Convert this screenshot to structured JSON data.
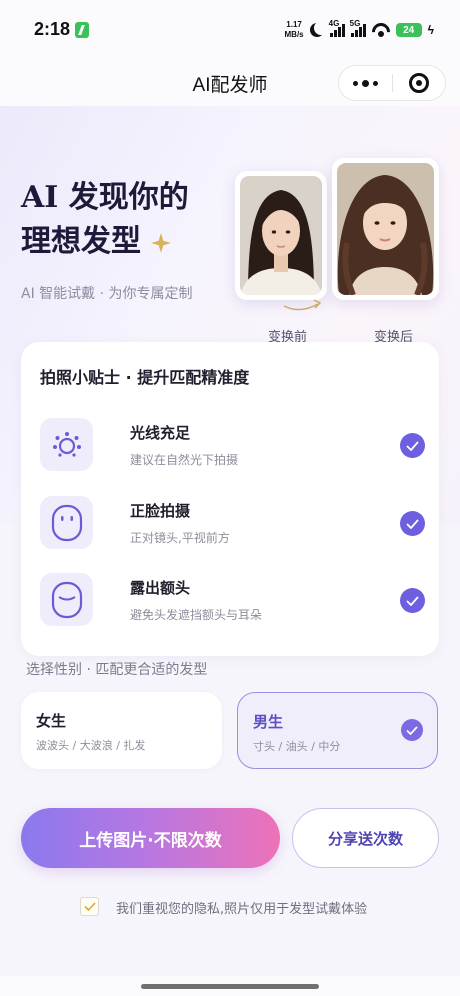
{
  "status_bar": {
    "time": "2:18",
    "net_speed_value": "1.17",
    "net_speed_unit": "MB/s",
    "signal_1_label": "4G",
    "signal_2_label": "5G",
    "battery": "24"
  },
  "nav": {
    "title": "AI配发师"
  },
  "hero": {
    "title_line1": "AI 发现你的",
    "title_line2": "理想发型",
    "subtitle": "AI 智能试戴 · 为你专属定制",
    "before_label": "变换前",
    "after_label": "变换后"
  },
  "tips": {
    "title": "拍照小贴士 · 提升匹配精准度",
    "items": [
      {
        "name": "光线充足",
        "desc": "建议在自然光下拍摄",
        "icon": "light-icon"
      },
      {
        "name": "正脸拍摄",
        "desc": "正对镜头,平视前方",
        "icon": "face-icon"
      },
      {
        "name": "露出额头",
        "desc": "避免头发遮挡额头与耳朵",
        "icon": "forehead-icon"
      }
    ]
  },
  "gender": {
    "heading": "选择性别 · 匹配更合适的发型",
    "female": {
      "name": "女生",
      "styles": "波波头 / 大波浪 / 扎发"
    },
    "male": {
      "name": "男生",
      "styles": "寸头 / 油头 / 中分",
      "selected": true
    }
  },
  "actions": {
    "upload": "上传图片·不限次数",
    "share": "分享送次数"
  },
  "privacy": {
    "text": "我们重视您的隐私,照片仅用于发型试戴体验",
    "checked": true
  },
  "colors": {
    "accent": "#6e5ee0",
    "gradient_start": "#8b79ee",
    "gradient_end": "#ee72b8",
    "status_green": "#3cc15a"
  }
}
